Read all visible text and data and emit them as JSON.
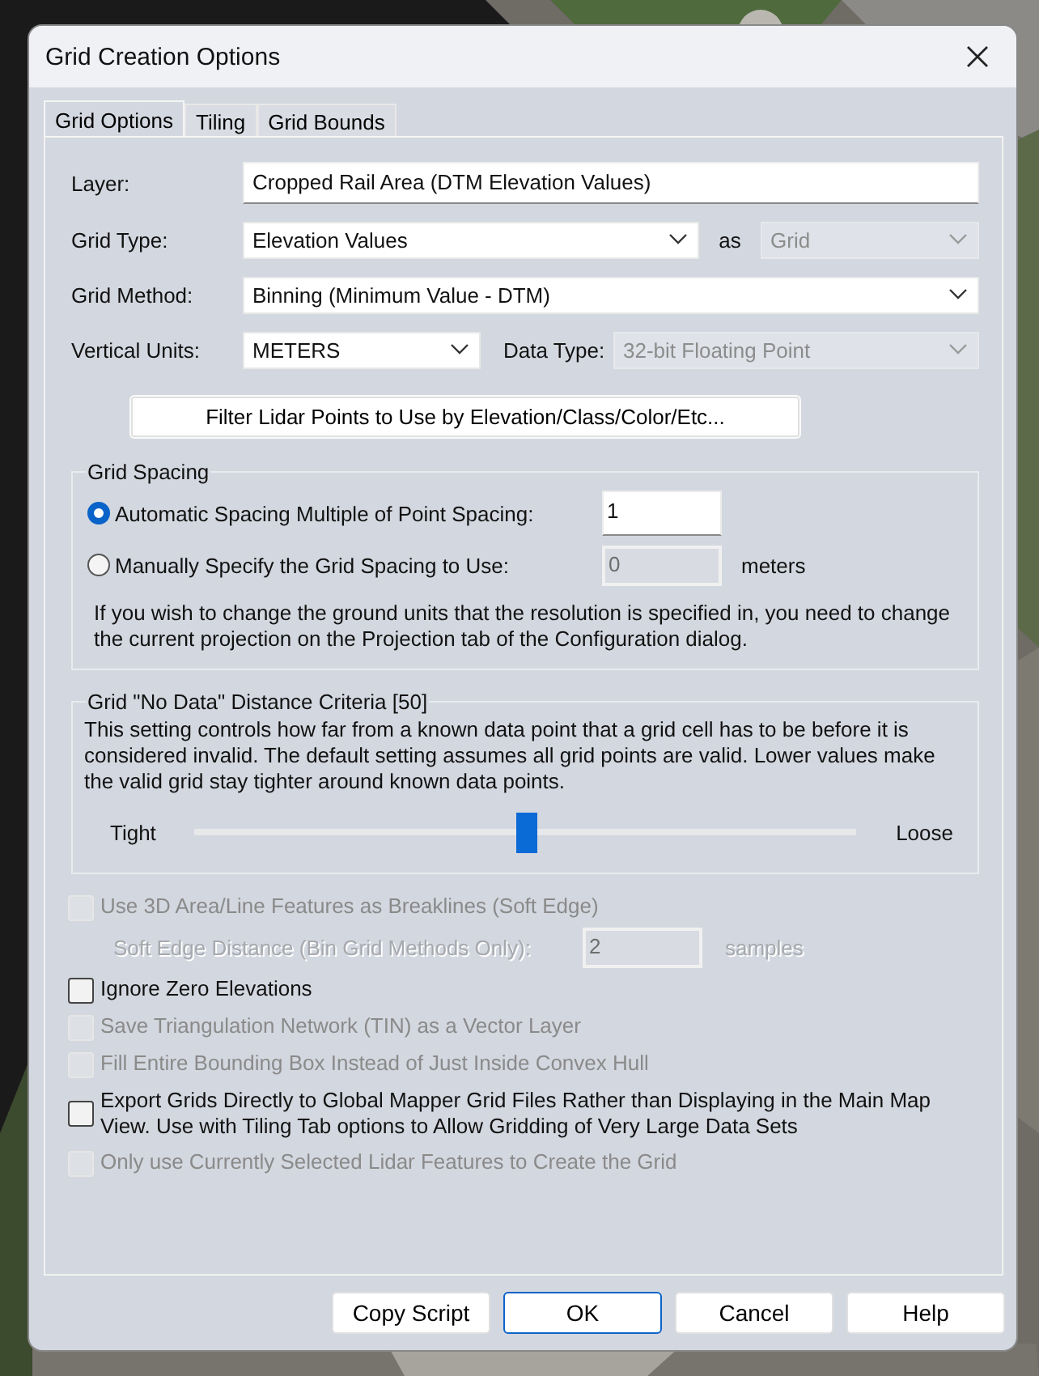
{
  "window": {
    "title": "Grid Creation Options"
  },
  "tabs": [
    {
      "label": "Grid Options",
      "selected": true
    },
    {
      "label": "Tiling",
      "selected": false
    },
    {
      "label": "Grid Bounds",
      "selected": false
    }
  ],
  "layer": {
    "label": "Layer:",
    "value": "Cropped Rail Area (DTM Elevation Values)"
  },
  "grid_type": {
    "label": "Grid Type:",
    "value": "Elevation Values",
    "as_label": "as",
    "as_value": "Grid",
    "as_disabled": true
  },
  "grid_method": {
    "label": "Grid Method:",
    "value": "Binning (Minimum Value - DTM)"
  },
  "vertical_units": {
    "label": "Vertical Units:",
    "value": "METERS"
  },
  "data_type": {
    "label": "Data Type:",
    "value": "32-bit Floating Point",
    "disabled": true
  },
  "filter_button": "Filter Lidar Points to Use by Elevation/Class/Color/Etc...",
  "grid_spacing": {
    "title": "Grid Spacing",
    "options": [
      {
        "label": "Automatic Spacing Multiple of Point Spacing:",
        "selected": true,
        "value": "1",
        "disabled": false
      },
      {
        "label": "Manually Specify the Grid Spacing to Use:",
        "selected": false,
        "value": "0",
        "unit": "meters",
        "disabled": true
      }
    ],
    "note": "If you wish to change the ground units that the resolution is specified in, you need to change the current projection on the Projection tab of the Configuration dialog."
  },
  "no_data": {
    "title": "Grid \"No Data\" Distance Criteria [50]",
    "description": "This setting controls how far from a known data point that a grid cell has to be before it is considered invalid. The default setting assumes all grid points are valid. Lower values make the valid grid stay tighter around known data points.",
    "min_label": "Tight",
    "max_label": "Loose",
    "level": 0.5
  },
  "options": [
    {
      "kind": "checkbox",
      "label": "Use 3D Area/Line Features as Breaklines (Soft Edge)",
      "checked": false,
      "disabled": true
    },
    {
      "kind": "field",
      "label": "Soft Edge Distance (Bin Grid Methods Only):",
      "value": "2",
      "unit": "samples",
      "disabled": true
    },
    {
      "kind": "checkbox",
      "label": "Ignore Zero Elevations",
      "checked": false,
      "disabled": false
    },
    {
      "kind": "checkbox",
      "label": "Save Triangulation Network (TIN) as a Vector Layer",
      "checked": false,
      "disabled": true
    },
    {
      "kind": "checkbox",
      "label": "Fill Entire Bounding Box Instead of Just Inside Convex Hull",
      "checked": false,
      "disabled": true
    },
    {
      "kind": "checkbox",
      "label": "Export Grids Directly to Global Mapper Grid Files Rather than Displaying in the Main Map View. Use with Tiling Tab options to Allow Gridding of Very Large Data Sets",
      "checked": false,
      "disabled": false
    },
    {
      "kind": "checkbox",
      "label": "Only use Currently Selected Lidar Features to Create the Grid",
      "checked": false,
      "disabled": true
    }
  ],
  "buttons": [
    {
      "label": "Copy Script",
      "default": false
    },
    {
      "label": "OK",
      "default": true
    },
    {
      "label": "Cancel",
      "default": false
    },
    {
      "label": "Help",
      "default": false
    }
  ]
}
